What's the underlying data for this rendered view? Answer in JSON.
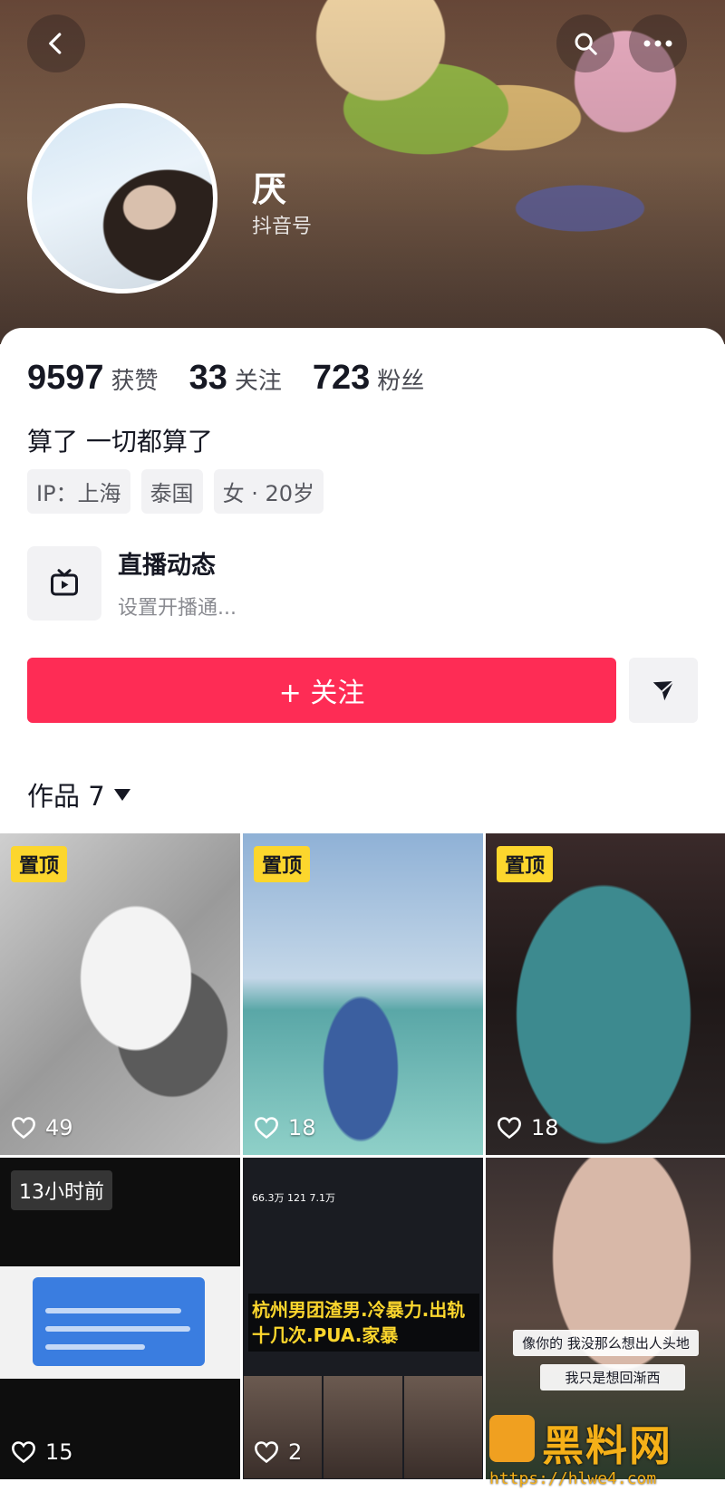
{
  "profile": {
    "nickname": "厌",
    "subline": "抖音号",
    "bio": "算了 一切都算了",
    "stats": [
      {
        "value": "9597",
        "label": "获赞"
      },
      {
        "value": "33",
        "label": "关注"
      },
      {
        "value": "723",
        "label": "粉丝"
      }
    ],
    "tags": [
      "IP：上海",
      "泰国",
      "女 · 20岁"
    ]
  },
  "live": {
    "title": "直播动态",
    "subtitle": "设置开播通..."
  },
  "actions": {
    "follow_label": "+ 关注"
  },
  "works": {
    "label": "作品 7"
  },
  "posts": [
    {
      "pinned": "置顶",
      "likes": "49"
    },
    {
      "pinned": "置顶",
      "likes": "18"
    },
    {
      "pinned": "置顶",
      "likes": "18"
    },
    {
      "time": "13小时前",
      "likes": "15"
    },
    {
      "overlay": "杭州男团渣男.冷暴力.出轨十几次.PUA.家暴",
      "mini": "66.3万  121  7.1万",
      "likes": "2"
    },
    {
      "caption1": "像你的 我没那么想出人头地",
      "caption2": "我只是想回渐西"
    }
  ],
  "watermark": {
    "brand": "黑料网",
    "url": "https://hlwe4.com"
  },
  "colors": {
    "accent": "#fe2c55",
    "pin": "#fcd62d"
  }
}
